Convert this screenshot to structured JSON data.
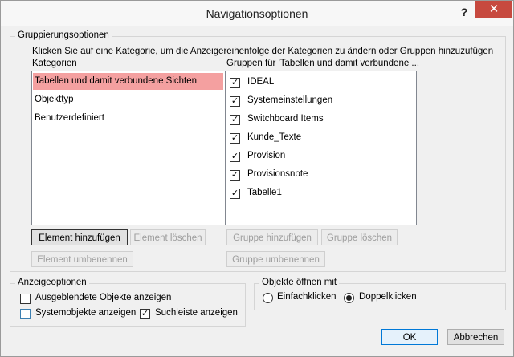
{
  "window": {
    "title": "Navigationsoptionen",
    "help_label": "?",
    "close_label": "✕"
  },
  "grouping": {
    "legend": "Gruppierungsoptionen",
    "instruction": "Klicken Sie auf eine Kategorie, um die Anzeigereihenfolge der Kategorien zu ändern oder Gruppen hinzuzufügen",
    "categories_label": "Kategorien",
    "groups_label": "Gruppen für 'Tabellen und damit verbundene ...",
    "categories": [
      {
        "label": "Tabellen und damit verbundene Sichten",
        "selected": true
      },
      {
        "label": "Objekttyp",
        "selected": false
      },
      {
        "label": "Benutzerdefiniert",
        "selected": false
      }
    ],
    "groups": [
      {
        "label": "IDEAL",
        "checked": true
      },
      {
        "label": "Systemeinstellungen",
        "checked": true
      },
      {
        "label": "Switchboard Items",
        "checked": true
      },
      {
        "label": "Kunde_Texte",
        "checked": true
      },
      {
        "label": "Provision",
        "checked": true
      },
      {
        "label": "Provisionsnote",
        "checked": true
      },
      {
        "label": "Tabelle1",
        "checked": true
      }
    ],
    "buttons": {
      "add_element": "Element hinzufügen",
      "delete_element": "Element löschen",
      "rename_element": "Element umbenennen",
      "add_group": "Gruppe hinzufügen",
      "delete_group": "Gruppe löschen",
      "rename_group": "Gruppe umbenennen"
    }
  },
  "display": {
    "legend": "Anzeigeoptionen",
    "show_hidden": {
      "label": "Ausgeblendete Objekte anzeigen",
      "checked": false
    },
    "show_system": {
      "label": "Systemobjekte anzeigen",
      "checked": false
    },
    "show_search": {
      "label": "Suchleiste anzeigen",
      "checked": true
    }
  },
  "open_objects": {
    "legend": "Objekte öffnen mit",
    "single_click": {
      "label": "Einfachklicken",
      "selected": false
    },
    "double_click": {
      "label": "Doppelklicken",
      "selected": true
    }
  },
  "footer": {
    "ok": "OK",
    "cancel": "Abbrechen"
  }
}
